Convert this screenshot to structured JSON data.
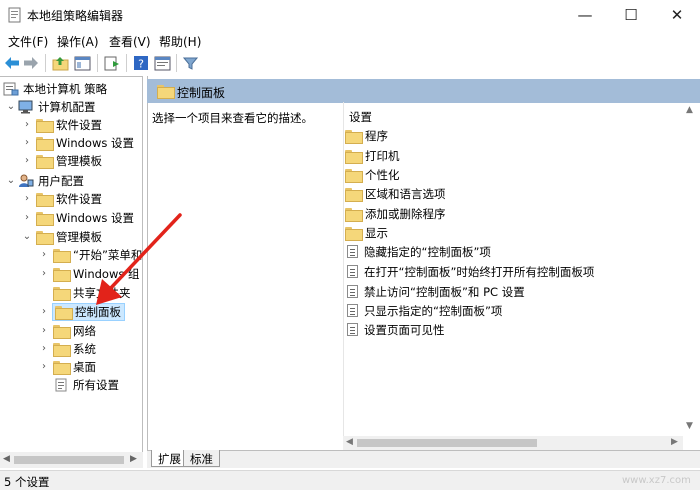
{
  "window": {
    "title": "本地组策略编辑器",
    "controls": {
      "minimize": "—",
      "maximize": "☐",
      "close": "✕"
    }
  },
  "menu": [
    "文件(F)",
    "操作(A)",
    "查看(V)",
    "帮助(H)"
  ],
  "tree": {
    "root": "本地计算机 策略",
    "computer_config": "计算机配置",
    "cc_software": "软件设置",
    "cc_windows": "Windows 设置",
    "cc_admin": "管理模板",
    "user_config": "用户配置",
    "uc_software": "软件设置",
    "uc_windows": "Windows 设置",
    "uc_admin": "管理模板",
    "start_menu": "“开始”菜单和",
    "windows_comp": "Windows 组",
    "shared": "共享文件夹",
    "control_panel": "控制面板",
    "network": "网络",
    "system": "系统",
    "desktop": "桌面",
    "all_settings": "所有设置"
  },
  "right_pane": {
    "header": "控制面板",
    "description": "选择一个项目来查看它的描述。",
    "column": "设置",
    "folders": [
      "程序",
      "打印机",
      "个性化",
      "区域和语言选项",
      "添加或删除程序",
      "显示"
    ],
    "settings": [
      "隐藏指定的“控制面板”项",
      "在打开“控制面板”时始终打开所有控制面板项",
      "禁止访问“控制面板”和 PC 设置",
      "只显示指定的“控制面板”项",
      "设置页面可见性"
    ]
  },
  "tabs": [
    "扩展",
    "标准"
  ],
  "status": "5 个设置",
  "watermark": "www.xz7.com"
}
